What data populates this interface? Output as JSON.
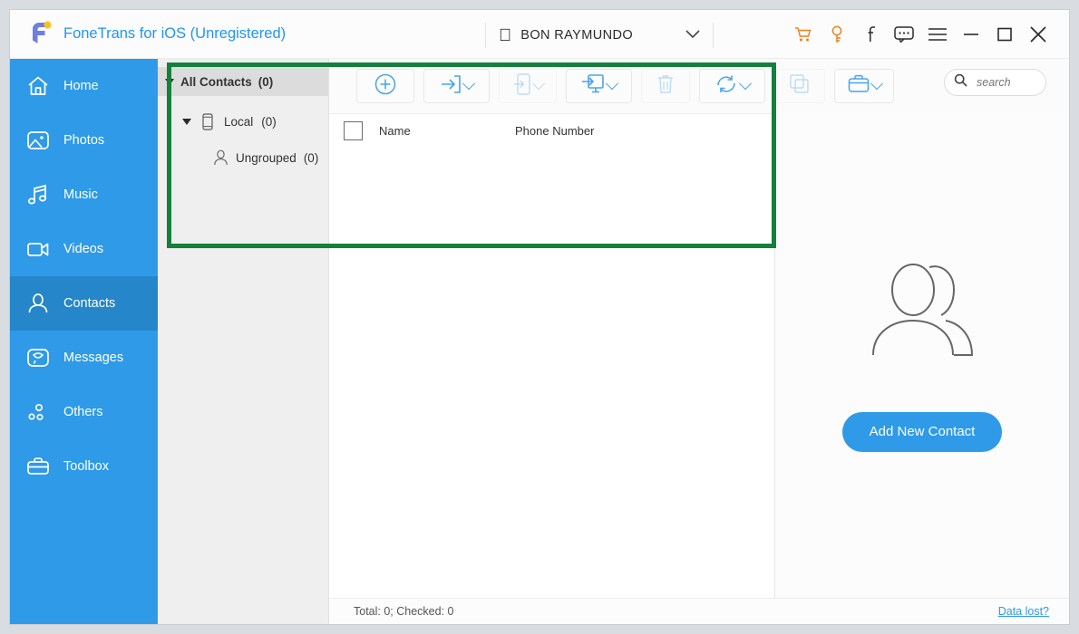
{
  "app": {
    "title": "FoneTrans for iOS (Unregistered)",
    "logo_icon": "fonetrans-logo-icon"
  },
  "header": {
    "device": {
      "platform_icon": "apple-icon",
      "name": "BON RAYMUNDO",
      "chevron_icon": "chevron-down-icon"
    },
    "icons": [
      {
        "name": "cart-icon",
        "color": "#ef7f1a"
      },
      {
        "name": "key-icon",
        "color": "#ef7f1a"
      },
      {
        "name": "facebook-icon",
        "color": "#2b2b2b"
      },
      {
        "name": "feedback-icon",
        "color": "#2b2b2b"
      },
      {
        "name": "menu-icon",
        "color": "#2b2b2b"
      },
      {
        "name": "minimize-icon",
        "color": "#2b2b2b"
      },
      {
        "name": "maximize-icon",
        "color": "#2b2b2b"
      },
      {
        "name": "close-icon",
        "color": "#2b2b2b"
      }
    ]
  },
  "sidebar": {
    "background": "#2f9ae8",
    "active_background": "#2586c9",
    "items": [
      {
        "label": "Home",
        "icon": "home-icon",
        "active": false
      },
      {
        "label": "Photos",
        "icon": "photos-icon",
        "active": false
      },
      {
        "label": "Music",
        "icon": "music-icon",
        "active": false
      },
      {
        "label": "Videos",
        "icon": "videos-icon",
        "active": false
      },
      {
        "label": "Contacts",
        "icon": "contacts-icon",
        "active": true
      },
      {
        "label": "Messages",
        "icon": "messages-icon",
        "active": false
      },
      {
        "label": "Others",
        "icon": "others-icon",
        "active": false
      },
      {
        "label": "Toolbox",
        "icon": "toolbox-icon",
        "active": false
      }
    ]
  },
  "tree": {
    "root": {
      "label": "All Contacts",
      "count": "(0)",
      "caret_icon": "caret-down-icon"
    },
    "local": {
      "label": "Local",
      "count": "(0)",
      "icon": "phone-icon",
      "caret_icon": "caret-down-icon"
    },
    "ungrouped": {
      "label": "Ungrouped",
      "count": "(0)",
      "icon": "person-icon"
    }
  },
  "toolbar": {
    "buttons": [
      {
        "name": "add-contact-button",
        "icon": "plus-circle-icon",
        "dropdown": false,
        "disabled": false
      },
      {
        "name": "import-button",
        "icon": "import-arrow-icon",
        "dropdown": true,
        "disabled": false
      },
      {
        "name": "export-to-device-button",
        "icon": "export-phone-icon",
        "dropdown": true,
        "disabled": true
      },
      {
        "name": "export-to-pc-button",
        "icon": "export-pc-icon",
        "dropdown": true,
        "disabled": false
      },
      {
        "name": "delete-button",
        "icon": "trash-icon",
        "dropdown": false,
        "disabled": true
      },
      {
        "name": "deduplicate-button",
        "icon": "refresh-icon",
        "dropdown": true,
        "disabled": false
      },
      {
        "name": "merge-button",
        "icon": "copy-icon",
        "dropdown": false,
        "disabled": true
      },
      {
        "name": "backup-restore-button",
        "icon": "briefcase-icon",
        "dropdown": true,
        "disabled": false
      }
    ],
    "search": {
      "placeholder": "search",
      "value": "",
      "icon": "search-icon"
    }
  },
  "list": {
    "select_all_checkbox": "select-all-checkbox",
    "columns": [
      "Name",
      "Phone Number"
    ],
    "rows": []
  },
  "empty_state": {
    "illustration_icon": "two-people-icon",
    "button_label": "Add New Contact"
  },
  "statusbar": {
    "totals": "Total: 0; Checked: 0",
    "data_lost_link": "Data lost?"
  },
  "annotation": {
    "highlight_color": "#14803c",
    "target": "contacts-tree-and-list-region"
  }
}
